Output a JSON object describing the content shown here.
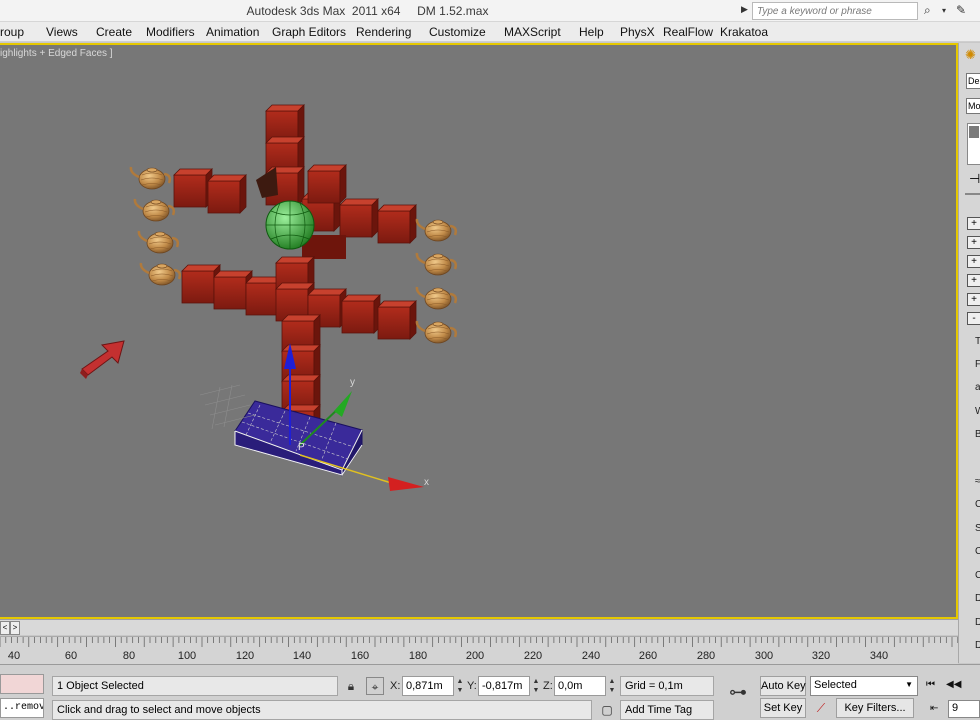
{
  "window": {
    "title": "Autodesk 3ds Max  2011 x64     DM 1.52.max",
    "search_placeholder": "Type a keyword or phrase"
  },
  "menu": [
    "roup",
    "Views",
    "Create",
    "Modifiers",
    "Animation",
    "Graph Editors",
    "Rendering",
    "Customize",
    "MAXScript",
    "Help",
    "PhysX",
    "RealFlow",
    "Krakatoa"
  ],
  "viewport": {
    "label": "ighlights + Edged Faces ]",
    "gizmo_labels": {
      "x": "x",
      "y": "y",
      "pivot": "P"
    }
  },
  "command_panel": {
    "dropdown_1": "De",
    "dropdown_2": "Mo",
    "plus": "+",
    "minus": "-",
    "letters": [
      "T",
      "F",
      "a",
      "W",
      "B",
      "≈",
      "C",
      "S",
      "C",
      "C",
      "D",
      "D",
      "D"
    ]
  },
  "timeline": {
    "prev_label": "<",
    "next_label": ">",
    "ticks": [
      "40",
      "60",
      "80",
      "100",
      "120",
      "140",
      "160",
      "180",
      "200",
      "220",
      "240",
      "260",
      "280",
      "300",
      "320",
      "340"
    ]
  },
  "status": {
    "maxscript_listener": "..remov",
    "selection_status": "1 Object Selected",
    "prompt": "Click and drag to select and move objects",
    "x_label": "X:",
    "x_value": "0,871m",
    "y_label": "Y:",
    "y_value": "-0,817m",
    "z_label": "Z:",
    "z_value": "0,0m",
    "grid": "Grid = 0,1m",
    "add_time_tag": "Add Time Tag",
    "auto_key": "Auto Key",
    "set_key": "Set Key",
    "key_mode": "Selected",
    "key_filters": "Key Filters...",
    "frame": "9"
  },
  "colors": {
    "viewport_bg": "#777777",
    "active_border": "#e5c800",
    "box_red": "#9a2418",
    "teapot": "#c08a48",
    "sphere_green": "#3fbf3f",
    "base_purple": "#3a2a9a"
  }
}
